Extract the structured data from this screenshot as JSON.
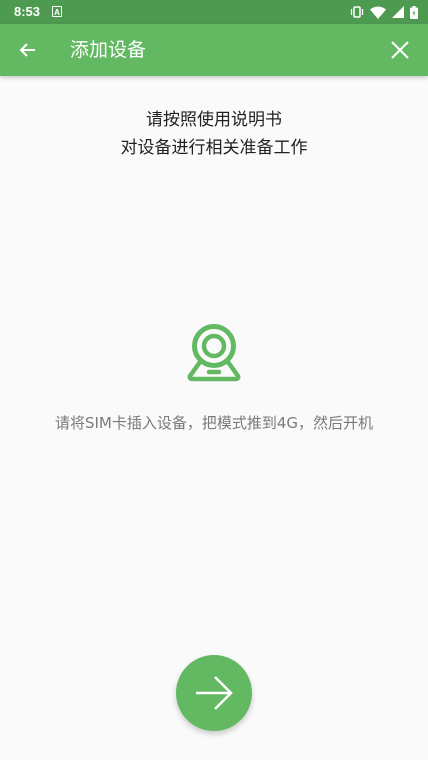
{
  "status_bar": {
    "time": "8:53",
    "notification_icon": "A",
    "icons": [
      "vibrate-icon",
      "wifi-icon",
      "signal-icon",
      "battery-icon"
    ]
  },
  "app_bar": {
    "title": "添加设备",
    "back_icon": "arrow-left-icon",
    "close_icon": "close-icon",
    "color": "#63b862"
  },
  "instructions": {
    "line1": "请按照使用说明书",
    "line2": "对设备进行相关准备工作"
  },
  "device": {
    "icon": "camera-icon",
    "hint": "请将SIM卡插入设备，把模式推到4G，然后开机"
  },
  "next_button": {
    "icon": "arrow-right-icon"
  },
  "colors": {
    "accent": "#63b862",
    "status_bar": "#4e9a51",
    "background": "#fafafa"
  }
}
